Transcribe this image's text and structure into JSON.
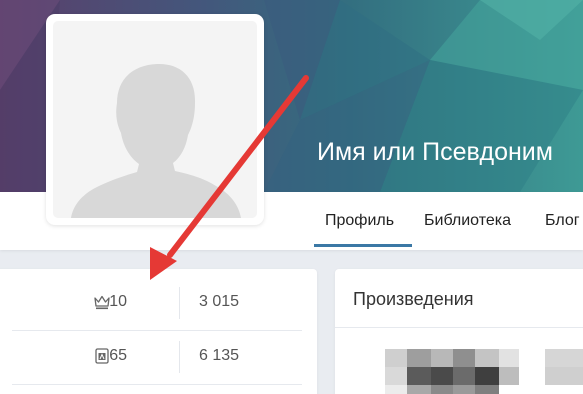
{
  "profile": {
    "name": "Имя или Псевдоним"
  },
  "nav": {
    "tabs": [
      {
        "label": "Профиль",
        "active": true
      },
      {
        "label": "Библиотека",
        "active": false
      },
      {
        "label": "Блог",
        "active": false
      }
    ]
  },
  "stats": [
    {
      "icon": "crown-icon",
      "value": "10",
      "secondary": "3 015"
    },
    {
      "icon": "book-icon",
      "value": "65",
      "secondary": "6 135"
    }
  ],
  "works": {
    "title": "Произведения"
  },
  "colors": {
    "accent": "#3b78a5",
    "arrow": "#e53935",
    "cover_left": "#5b3f6b",
    "cover_right": "#3e9a95"
  }
}
